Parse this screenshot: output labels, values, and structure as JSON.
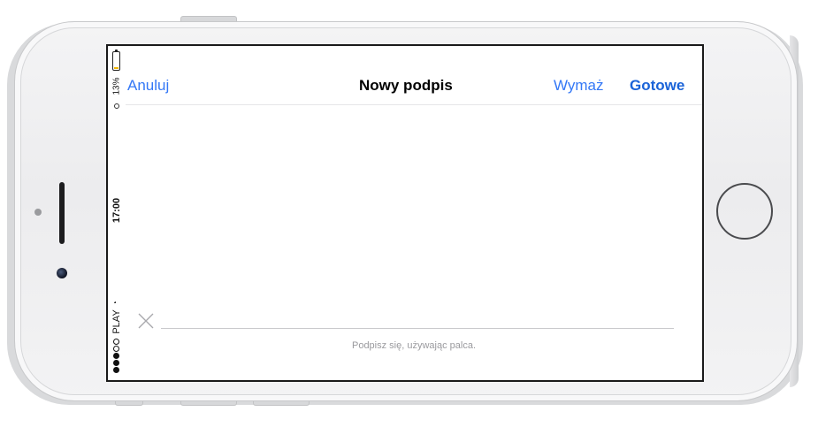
{
  "navbar": {
    "cancel_label": "Anuluj",
    "title": "Nowy podpis",
    "erase_label": "Wymaż",
    "done_label": "Gotowe"
  },
  "statusbar": {
    "carrier": "PLAY",
    "time": "17:00",
    "battery_percent": "13%",
    "battery_level": 0.13,
    "signal_bars_filled": 3,
    "signal_bars_total": 5
  },
  "signature": {
    "hint": "Podpisz się, używając palca."
  },
  "colors": {
    "accent": "#3478f6",
    "done": "#1a63d8",
    "battery_low": "#f2b705"
  },
  "icons": [
    "battery-icon",
    "alarm-icon",
    "wifi-icon",
    "signal-icon",
    "clear-x-icon",
    "home-button"
  ]
}
